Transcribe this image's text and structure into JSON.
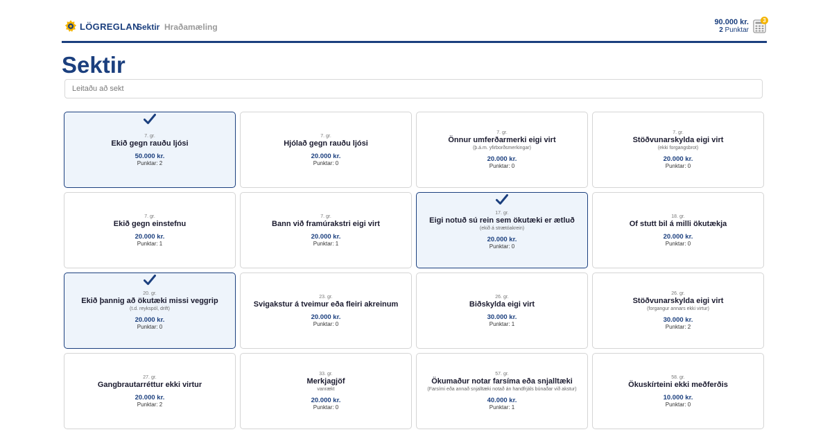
{
  "header": {
    "logo_text": "LÖGREGLAN",
    "nav": [
      {
        "label": "Sektir",
        "active": true
      },
      {
        "label": "Hraðamæling",
        "active": false
      }
    ],
    "summary": {
      "amount": "90.000 kr.",
      "points_value": "2",
      "points_label": "Punktar"
    },
    "calculator_badge": "3",
    "colors": {
      "brand": "#1b3f7e",
      "badge": "#f4b400"
    }
  },
  "page": {
    "title": "Sektir",
    "search_placeholder": "Leitaðu að sekt"
  },
  "cards": [
    {
      "article": "7. gr.",
      "name": "Ekið gegn rauðu ljósi",
      "sub": "",
      "price": "50.000 kr.",
      "points": "Punktar: 2",
      "selected": true
    },
    {
      "article": "7. gr.",
      "name": "Hjólað gegn rauðu ljósi",
      "sub": "",
      "price": "20.000 kr.",
      "points": "Punktar: 0",
      "selected": false
    },
    {
      "article": "7. gr.",
      "name": "Önnur umferðarmerki eigi virt",
      "sub": "(þ.á.m. yfirborðsmerkingar)",
      "price": "20.000 kr.",
      "points": "Punktar: 0",
      "selected": false
    },
    {
      "article": "7. gr.",
      "name": "Stöðvunarskylda eigi virt",
      "sub": "(ekki forgangsbrot)",
      "price": "20.000 kr.",
      "points": "Punktar: 0",
      "selected": false
    },
    {
      "article": "7. gr.",
      "name": "Ekið gegn einstefnu",
      "sub": "",
      "price": "20.000 kr.",
      "points": "Punktar: 1",
      "selected": false
    },
    {
      "article": "7. gr.",
      "name": "Bann við framúrakstri eigi virt",
      "sub": "",
      "price": "20.000 kr.",
      "points": "Punktar: 1",
      "selected": false
    },
    {
      "article": "17. gr.",
      "name": "Eigi notuð sú rein sem ökutæki er ætluð",
      "sub": "(ekið á strætóakrein)",
      "price": "20.000 kr.",
      "points": "Punktar: 0",
      "selected": true
    },
    {
      "article": "18. gr.",
      "name": "Of stutt bil á milli ökutækja",
      "sub": "",
      "price": "20.000 kr.",
      "points": "Punktar: 0",
      "selected": false
    },
    {
      "article": "20. gr.",
      "name": "Ekið þannig að ökutæki missi veggrip",
      "sub": "(t.d. reykspól, drift)",
      "price": "20.000 kr.",
      "points": "Punktar: 0",
      "selected": true
    },
    {
      "article": "23. gr.",
      "name": "Svigakstur á tveimur eða fleiri akreinum",
      "sub": "",
      "price": "20.000 kr.",
      "points": "Punktar: 0",
      "selected": false
    },
    {
      "article": "26. gr.",
      "name": "Biðskylda eigi virt",
      "sub": "",
      "price": "30.000 kr.",
      "points": "Punktar: 1",
      "selected": false
    },
    {
      "article": "26. gr.",
      "name": "Stöðvunarskylda eigi virt",
      "sub": "(forgangur annars ekki virtur)",
      "price": "30.000 kr.",
      "points": "Punktar: 2",
      "selected": false
    },
    {
      "article": "27. gr.",
      "name": "Gangbrautarréttur ekki virtur",
      "sub": "",
      "price": "20.000 kr.",
      "points": "Punktar: 2",
      "selected": false
    },
    {
      "article": "33. gr.",
      "name": "Merkjagjöf",
      "sub": "vanrækt",
      "price": "20.000 kr.",
      "points": "Punktar: 0",
      "selected": false
    },
    {
      "article": "57. gr.",
      "name": "Ökumaður notar farsíma eða snjalltæki",
      "sub": "(Farsími eða annað snjalltæki notað án handfrjáls búnaðar við akstur)",
      "price": "40.000 kr.",
      "points": "Punktar: 1",
      "selected": false
    },
    {
      "article": "58. gr.",
      "name": "Ökuskírteini ekki meðferðis",
      "sub": "",
      "price": "10.000 kr.",
      "points": "Punktar: 0",
      "selected": false
    }
  ]
}
